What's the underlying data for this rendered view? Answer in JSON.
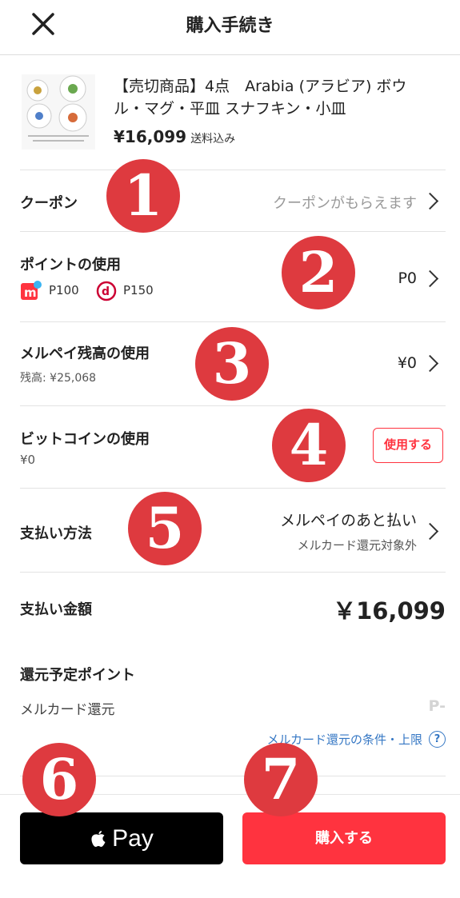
{
  "header": {
    "title": "購入手続き",
    "close_icon": "close-icon"
  },
  "product": {
    "title": "【売切商品】4点　Arabia (アラビア) ボウル・マグ・平皿 スナフキン・小皿",
    "price": "¥16,099",
    "shipping_note": "送料込み"
  },
  "coupon": {
    "label": "クーポン",
    "value": "クーポンがもらえます"
  },
  "points": {
    "label": "ポイントの使用",
    "merpoint": "P100",
    "dpoint": "P150",
    "value": "P0"
  },
  "merpay_balance": {
    "label": "メルペイ残高の使用",
    "balance": "残高: ¥25,068",
    "value": "¥0"
  },
  "bitcoin": {
    "label": "ビットコインの使用",
    "amount": "¥0",
    "button": "使用する"
  },
  "payment_method": {
    "label": "支払い方法",
    "value": "メルペイのあと払い",
    "note": "メルカード還元対象外"
  },
  "total": {
    "label": "支払い金額",
    "value": "￥16,099"
  },
  "reward": {
    "label": "還元予定ポイント",
    "card_label": "メルカード還元",
    "card_value": "P-",
    "link": "メルカード還元の条件・上限"
  },
  "footer": {
    "applepay_label": "Pay",
    "purchase_label": "購入する"
  },
  "badges": [
    "1",
    "2",
    "3",
    "4",
    "5",
    "6",
    "7"
  ],
  "colors": {
    "accent_red": "#ff333f",
    "badge_red": "#de3a3f",
    "link_blue": "#3577c4"
  }
}
